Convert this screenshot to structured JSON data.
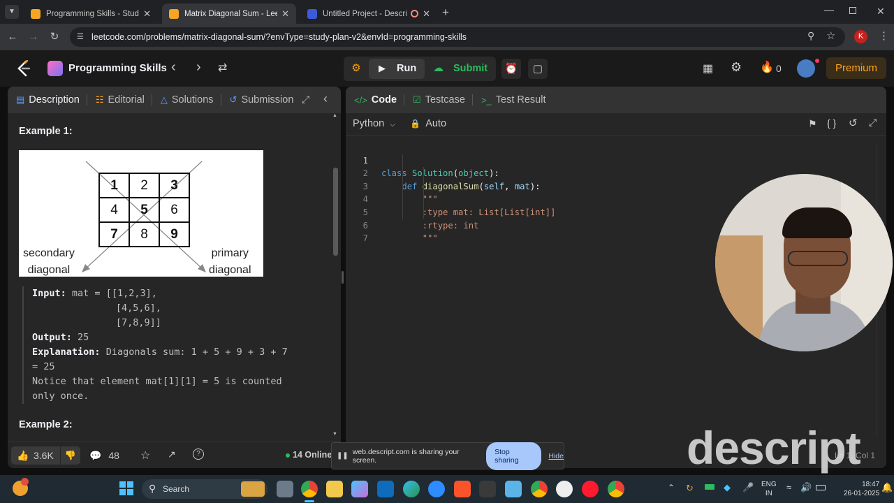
{
  "browser": {
    "tabs": [
      {
        "title": "Programming Skills - Study Pla",
        "active": false,
        "color": "#f5a623"
      },
      {
        "title": "Matrix Diagonal Sum - LeetCod",
        "active": true,
        "color": "#f5a623"
      },
      {
        "title": "Untitled Project - Descript",
        "active": false,
        "color": "#3b5bdb"
      }
    ],
    "url": "leetcode.com/problems/matrix-diagonal-sum/?envType=study-plan-v2&envId=programming-skills",
    "profile_initial": "K"
  },
  "header": {
    "study_plan_title": "Programming Skills",
    "run_label": "Run",
    "submit_label": "Submit",
    "streak_count": "0",
    "premium_label": "Premium"
  },
  "left": {
    "tabs": [
      "Description",
      "Editorial",
      "Solutions",
      "Submission"
    ],
    "example1_heading": "Example 1:",
    "matrix": [
      [
        "1",
        "2",
        "3"
      ],
      [
        "4",
        "5",
        "6"
      ],
      [
        "7",
        "8",
        "9"
      ]
    ],
    "secondary_label": [
      "secondary",
      "diagonal"
    ],
    "primary_label": [
      "primary",
      "diagonal"
    ],
    "input_label": "Input:",
    "input_lines": [
      "mat = [[1,2,3],",
      "       [4,5,6],",
      "       [7,8,9]]"
    ],
    "output_label": "Output:",
    "output_value": "25",
    "explanation_label": "Explanation:",
    "explanation_lines": [
      "Diagonals sum: 1 + 5 + 9 + 3 + 7",
      "= 25",
      "Notice that element mat[1][1] = 5 is counted",
      "only once."
    ],
    "example2_heading": "Example 2:",
    "likes": "3.6K",
    "comments": "48",
    "online": "14 Online"
  },
  "right": {
    "tabs": [
      "Code",
      "Testcase",
      "Test Result"
    ],
    "language": "Python",
    "auto_label": "Auto",
    "code_lines": [
      {
        "n": "1",
        "text": "class Solution(object):"
      },
      {
        "n": "2",
        "text": "    def diagonalSum(self, mat):"
      },
      {
        "n": "3",
        "text": "        \"\"\""
      },
      {
        "n": "4",
        "text": "        :type mat: List[List[int]]"
      },
      {
        "n": "5",
        "text": "        :rtype: int"
      },
      {
        "n": "6",
        "text": "        \"\"\""
      },
      {
        "n": "7",
        "text": ""
      }
    ],
    "cursor_pos": "Ln 1, Col 1"
  },
  "share": {
    "message": "web.descript.com is sharing your screen.",
    "stop_label": "Stop sharing",
    "hide_label": "Hide"
  },
  "watermark": "descript",
  "taskbar": {
    "search_label": "Search",
    "lang_line1": "ENG",
    "lang_line2": "IN",
    "time": "18:47",
    "date": "26-01-2025"
  },
  "colors": {
    "accent_green": "#2cbb5d",
    "premium": "#ffa116",
    "link_blue": "#5a9bff"
  }
}
